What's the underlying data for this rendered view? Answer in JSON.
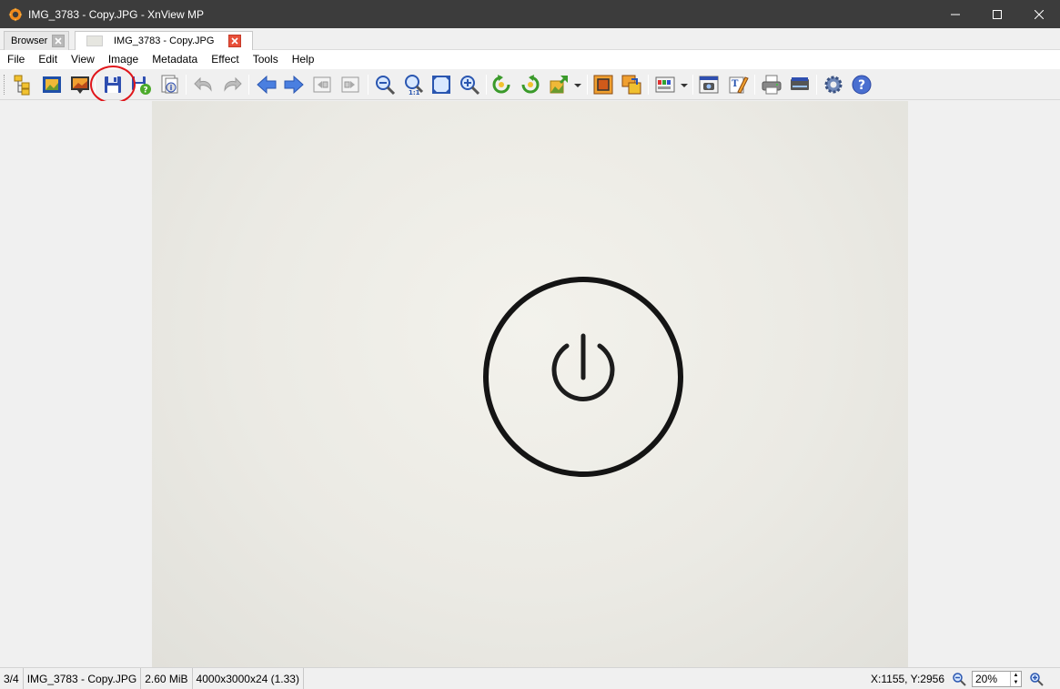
{
  "window": {
    "title": "IMG_3783 - Copy.JPG - XnView MP",
    "app_icon": "xnview-logo-icon",
    "controls": [
      "minimize-icon",
      "maximize-icon",
      "close-icon"
    ]
  },
  "tabs": [
    {
      "label": "Browser",
      "active": false
    },
    {
      "label": "IMG_3783 - Copy.JPG",
      "active": true
    }
  ],
  "menu": {
    "items": [
      "File",
      "Edit",
      "View",
      "Image",
      "Metadata",
      "Effect",
      "Tools",
      "Help"
    ]
  },
  "toolbar": {
    "buttons": [
      "browser-tree-icon",
      "fullscreen-icon",
      "slideshow-icon",
      "save-icon",
      "save-as-icon",
      "image-info-icon",
      "undo-icon",
      "redo-icon",
      "previous-icon",
      "next-icon",
      "first-image-icon",
      "last-image-icon",
      "zoom-out-icon",
      "actual-size-icon",
      "fit-to-window-icon",
      "zoom-in-icon",
      "rotate-left-icon",
      "rotate-right-icon",
      "transform-icon",
      "crop-icon",
      "resize-icon",
      "adjust-colors-icon",
      "capture-icon",
      "edit-text-icon",
      "print-icon",
      "scan-icon",
      "settings-icon",
      "help-icon"
    ],
    "highlight_color": "#e0151a"
  },
  "viewer": {
    "image_subject": "power-symbol-icon"
  },
  "status": {
    "index": "3/4",
    "filename": "IMG_3783 - Copy.JPG",
    "filesize": "2.60 MiB",
    "dimensions": "4000x3000x24 (1.33)",
    "coords": "X:1155, Y:2956",
    "zoom": "20%"
  }
}
